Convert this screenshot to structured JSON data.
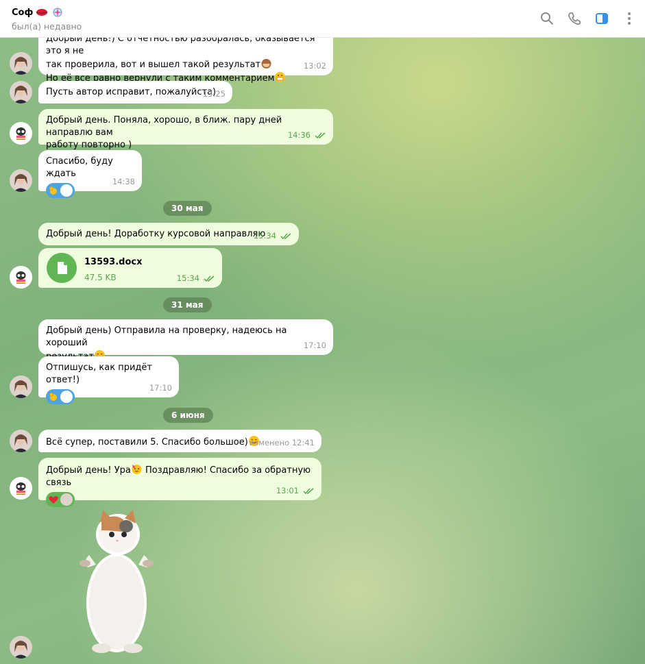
{
  "header": {
    "name": "Соф",
    "status": "был(а) недавно"
  },
  "messages": [
    {
      "text1": "Добрый день!) С отчетностью разобралась, оказывается это я не",
      "text2": "так проверила, вот и вышел такой результат",
      "text3": "Но её все равно вернули с таким комментарием",
      "time": "13:02"
    },
    {
      "text": "Пусть автор исправит, пожалуйста)",
      "time": "13:25"
    },
    {
      "text1": "Добрый день. Поняла, хорошо, в ближ. пару дней направлю вам",
      "text2": "работу повторно )",
      "time": "14:36"
    },
    {
      "text": "Спасибо, буду ждать",
      "time": "14:38"
    },
    {
      "text": "Добрый день! Доработку курсовой направляю",
      "time": "15:34"
    },
    {
      "file_name": "13593.docx",
      "file_size": "47.5 KB",
      "time": "15:34"
    },
    {
      "text1": "Добрый день) Отправила на проверку, надеюсь на хороший",
      "text2": "результат",
      "time": "17:10"
    },
    {
      "text": "Отпишусь, как придёт ответ!)",
      "time": "17:10"
    },
    {
      "text": "Всё супер, поставили 5. Спасибо большое)",
      "time": "изменено 12:41"
    },
    {
      "text1": "Добрый день! Ура",
      "text2": "Поздравляю! Спасибо за обратную связь",
      "time": "13:01"
    }
  ],
  "dates": [
    "30 мая",
    "31 мая",
    "6 июня"
  ],
  "colors": {
    "incoming": "#ffffff",
    "outgoing": "#effdde",
    "accent": "#5aa54d",
    "header_icon": "#3390ec"
  }
}
